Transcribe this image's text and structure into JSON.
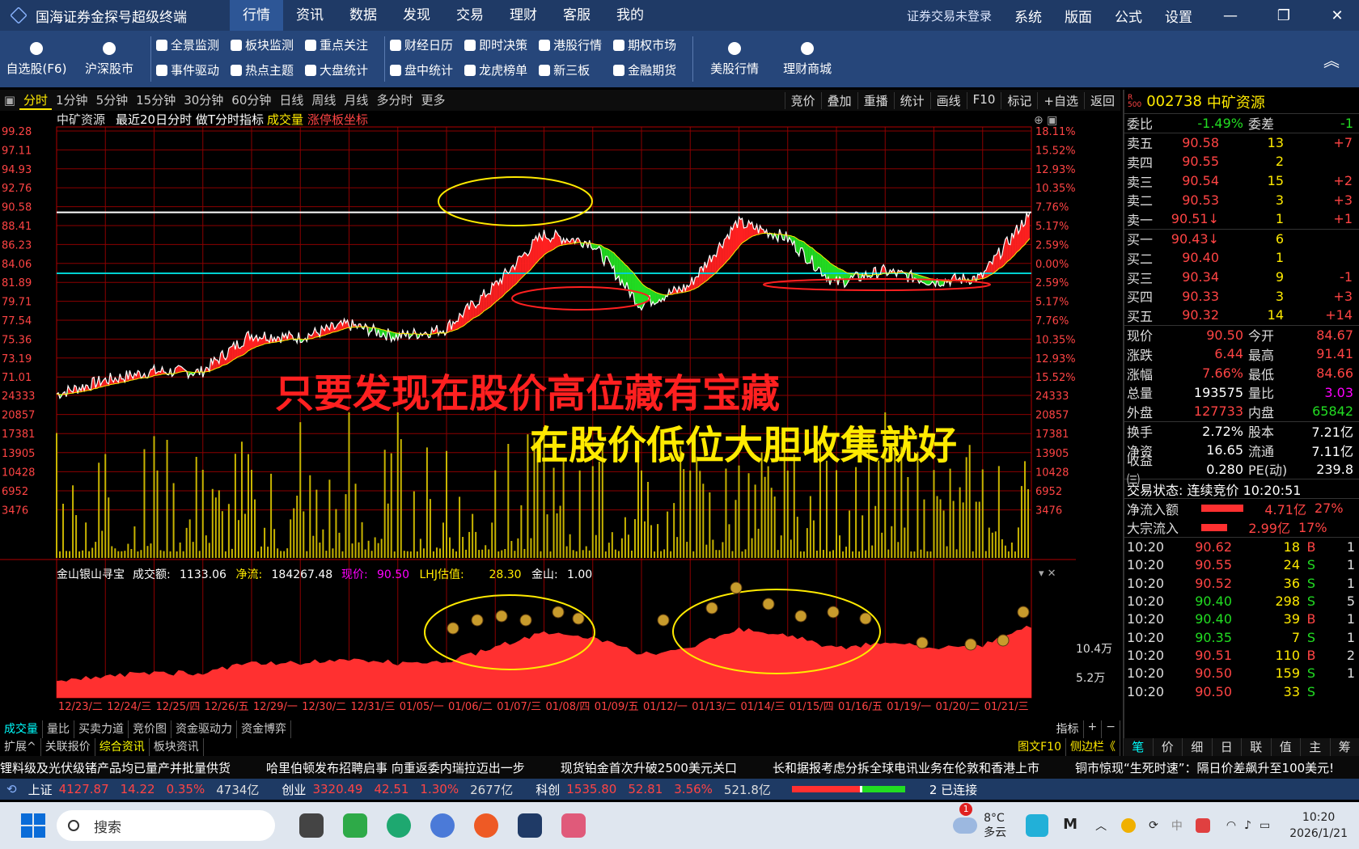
{
  "app": {
    "title": "国海证券金探号超级终端",
    "menu": [
      "行情",
      "资讯",
      "数据",
      "发现",
      "交易",
      "理财",
      "客服",
      "我的"
    ],
    "login": "证券交易未登录",
    "right_menu": [
      "系统",
      "版面",
      "公式",
      "设置"
    ]
  },
  "toolbar": {
    "big": [
      "自选股(F6)",
      "沪深股市"
    ],
    "cols": [
      [
        "全景监测",
        "事件驱动"
      ],
      [
        "板块监测",
        "热点主题"
      ],
      [
        "重点关注",
        "大盘统计"
      ],
      [
        "财经日历",
        "盘中统计"
      ],
      [
        "即时决策",
        "龙虎榜单"
      ],
      [
        "港股行情",
        "新三板"
      ],
      [
        "期权市场",
        "金融期货"
      ]
    ],
    "big2": [
      "美股行情",
      "理财商城"
    ]
  },
  "periods": [
    "分时",
    "1分钟",
    "5分钟",
    "15分钟",
    "30分钟",
    "60分钟",
    "日线",
    "周线",
    "月线",
    "多分时",
    "更多"
  ],
  "period_right": [
    "竞价",
    "叠加",
    "重播",
    "统计",
    "画线",
    "F10",
    "标记",
    "+自选",
    "返回"
  ],
  "chart": {
    "header": {
      "stock": "中矿资源",
      "title": "最近20日分时 做T分时指标",
      "vol": "成交量",
      "limit": "涨停板坐标"
    },
    "left_ticks": [
      "99.28",
      "97.11",
      "94.93",
      "92.76",
      "90.58",
      "88.41",
      "86.23",
      "84.06",
      "81.89",
      "79.71",
      "77.54",
      "75.36",
      "73.19",
      "71.01"
    ],
    "right_ticks": [
      "18.11%",
      "15.52%",
      "12.93%",
      "10.35%",
      "7.76%",
      "5.17%",
      "2.59%",
      "0.00%",
      "2.59%",
      "5.17%",
      "7.76%",
      "10.35%",
      "12.93%",
      "15.52%"
    ],
    "vol_ticks": [
      "24333",
      "20857",
      "17381",
      "13905",
      "10428",
      "6952",
      "3476"
    ],
    "caption1": "只要发现在股价高位藏有宝藏",
    "caption2": "在股价低位大胆收集就好",
    "sub": {
      "name": "金山银山寻宝",
      "amt_label": "成交额:",
      "amt": "1133.06",
      "net_label": "净流:",
      "net": "184267.48",
      "price_label": "现价:",
      "price": "90.50",
      "lhj_label": "LHJ估值:",
      "lhj": "28.30",
      "js_label": "金山:",
      "js": "1.00",
      "ticks": [
        "10.4万",
        "5.2万"
      ]
    },
    "dates": [
      "12/23/二",
      "12/24/三",
      "12/25/四",
      "12/26/五",
      "12/29/一",
      "12/30/二",
      "12/31/三",
      "01/05/一",
      "01/06/二",
      "01/07/三",
      "01/08/四",
      "01/09/五",
      "01/12/一",
      "01/13/二",
      "01/14/三",
      "01/15/四",
      "01/16/五",
      "01/19/一",
      "01/20/二",
      "01/21/三"
    ],
    "colors": {
      "up": "#ff2020",
      "down": "#22dd22",
      "yellow": "#ffea00",
      "cyan": "#00d0d0"
    }
  },
  "chart_data": {
    "type": "line",
    "x_unit": "trading day",
    "y_range": [
      71.01,
      99.28
    ],
    "prev_close": 84.06,
    "limit_price": 90.58,
    "days": [
      "12/23",
      "12/24",
      "12/25",
      "12/26",
      "12/29",
      "12/30",
      "12/31",
      "01/05",
      "01/06",
      "01/07",
      "01/08",
      "01/09",
      "01/12",
      "01/13",
      "01/14",
      "01/15",
      "01/16",
      "01/19",
      "01/20",
      "01/21"
    ],
    "day_close": [
      72.6,
      73.6,
      73.5,
      77.5,
      77.2,
      78.6,
      77.3,
      78.1,
      82.6,
      88.2,
      87.4,
      80.7,
      82.7,
      89.5,
      87.9,
      83.0,
      84.3,
      83.2,
      83.6,
      90.5
    ]
  },
  "bottom_tabs": [
    "成交量",
    "量比",
    "买卖力道",
    "竞价图",
    "资金驱动力",
    "资金博弈"
  ],
  "bottom_tabs2": [
    "扩展^",
    "关联报价",
    "综合资讯",
    "板块资讯"
  ],
  "ind_label": "指标",
  "f10_label": "图文F10",
  "side_label": "侧边栏《",
  "quote": {
    "badge": "R\n500",
    "code": "002738",
    "name": "中矿资源",
    "webi_l": "委比",
    "webi_v": "-1.49%",
    "webi_l2": "委差",
    "webi_v2": "-1",
    "asks": [
      [
        "卖五",
        "90.58",
        "13",
        "+7"
      ],
      [
        "卖四",
        "90.55",
        "2",
        ""
      ],
      [
        "卖三",
        "90.54",
        "15",
        "+2"
      ],
      [
        "卖二",
        "90.53",
        "3",
        "+3"
      ],
      [
        "卖一",
        "90.51↓",
        "1",
        "+1"
      ]
    ],
    "bids": [
      [
        "买一",
        "90.43↓",
        "6",
        ""
      ],
      [
        "买二",
        "90.40",
        "1",
        ""
      ],
      [
        "买三",
        "90.34",
        "9",
        "-1"
      ],
      [
        "买四",
        "90.33",
        "3",
        "+3"
      ],
      [
        "买五",
        "90.32",
        "14",
        "+14"
      ]
    ],
    "stats": [
      [
        "现价",
        "90.50",
        "今开",
        "84.67"
      ],
      [
        "涨跌",
        "6.44",
        "最高",
        "91.41"
      ],
      [
        "涨幅",
        "7.66%",
        "最低",
        "84.66"
      ],
      [
        "总量",
        "193575",
        "量比",
        "3.03"
      ],
      [
        "外盘",
        "127733",
        "内盘",
        "65842"
      ]
    ],
    "stats2": [
      [
        "换手",
        "2.72%",
        "股本",
        "7.21亿"
      ],
      [
        "净资",
        "16.65",
        "流通",
        "7.11亿"
      ],
      [
        "收益㈢",
        "0.280",
        "PE(动)",
        "239.8"
      ]
    ],
    "trade_state": "交易状态: 连续竞价 10:20:51",
    "flows": [
      [
        "净流入额",
        "4.71亿",
        "27%"
      ],
      [
        "大宗流入",
        "2.99亿",
        "17%"
      ]
    ],
    "ticks": [
      [
        "10:20",
        "90.62",
        "18",
        "B",
        "1"
      ],
      [
        "10:20",
        "90.55",
        "24",
        "S",
        "1"
      ],
      [
        "10:20",
        "90.52",
        "36",
        "S",
        "1"
      ],
      [
        "10:20",
        "90.40",
        "298",
        "S",
        "5"
      ],
      [
        "10:20",
        "90.40",
        "39",
        "B",
        "1"
      ],
      [
        "10:20",
        "90.35",
        "7",
        "S",
        "1"
      ],
      [
        "10:20",
        "90.51",
        "110",
        "B",
        "2"
      ],
      [
        "10:20",
        "90.50",
        "159",
        "S",
        "1"
      ],
      [
        "10:20",
        "90.50",
        "33",
        "S",
        ""
      ]
    ],
    "tabs": [
      "笔",
      "价",
      "细",
      "日",
      "联",
      "值",
      "主",
      "筹"
    ]
  },
  "news": [
    "锂料级及光伏级锗产品均已量产并批量供货",
    "哈里伯顿发布招聘启事 向重返委内瑞拉迈出一步",
    "现货铂金首次升破2500美元关口",
    "长和据报考虑分拆全球电讯业务在伦敦和香港上市",
    "铜市惊现“生死时速”：隔日价差飙升至100美元!"
  ],
  "indices": [
    [
      "上证",
      "4127.87",
      "14.22",
      "0.35%",
      "4734亿"
    ],
    [
      "创业",
      "3320.49",
      "42.51",
      "1.30%",
      "2677亿"
    ],
    [
      "科创",
      "1535.80",
      "52.81",
      "3.56%",
      "521.8亿"
    ]
  ],
  "conn": "2 已连接",
  "taskbar": {
    "search": "搜索",
    "weather_temp": "8°C",
    "weather_desc": "多云",
    "badge": "1",
    "time": "10:20",
    "date": "2026/1/21"
  }
}
